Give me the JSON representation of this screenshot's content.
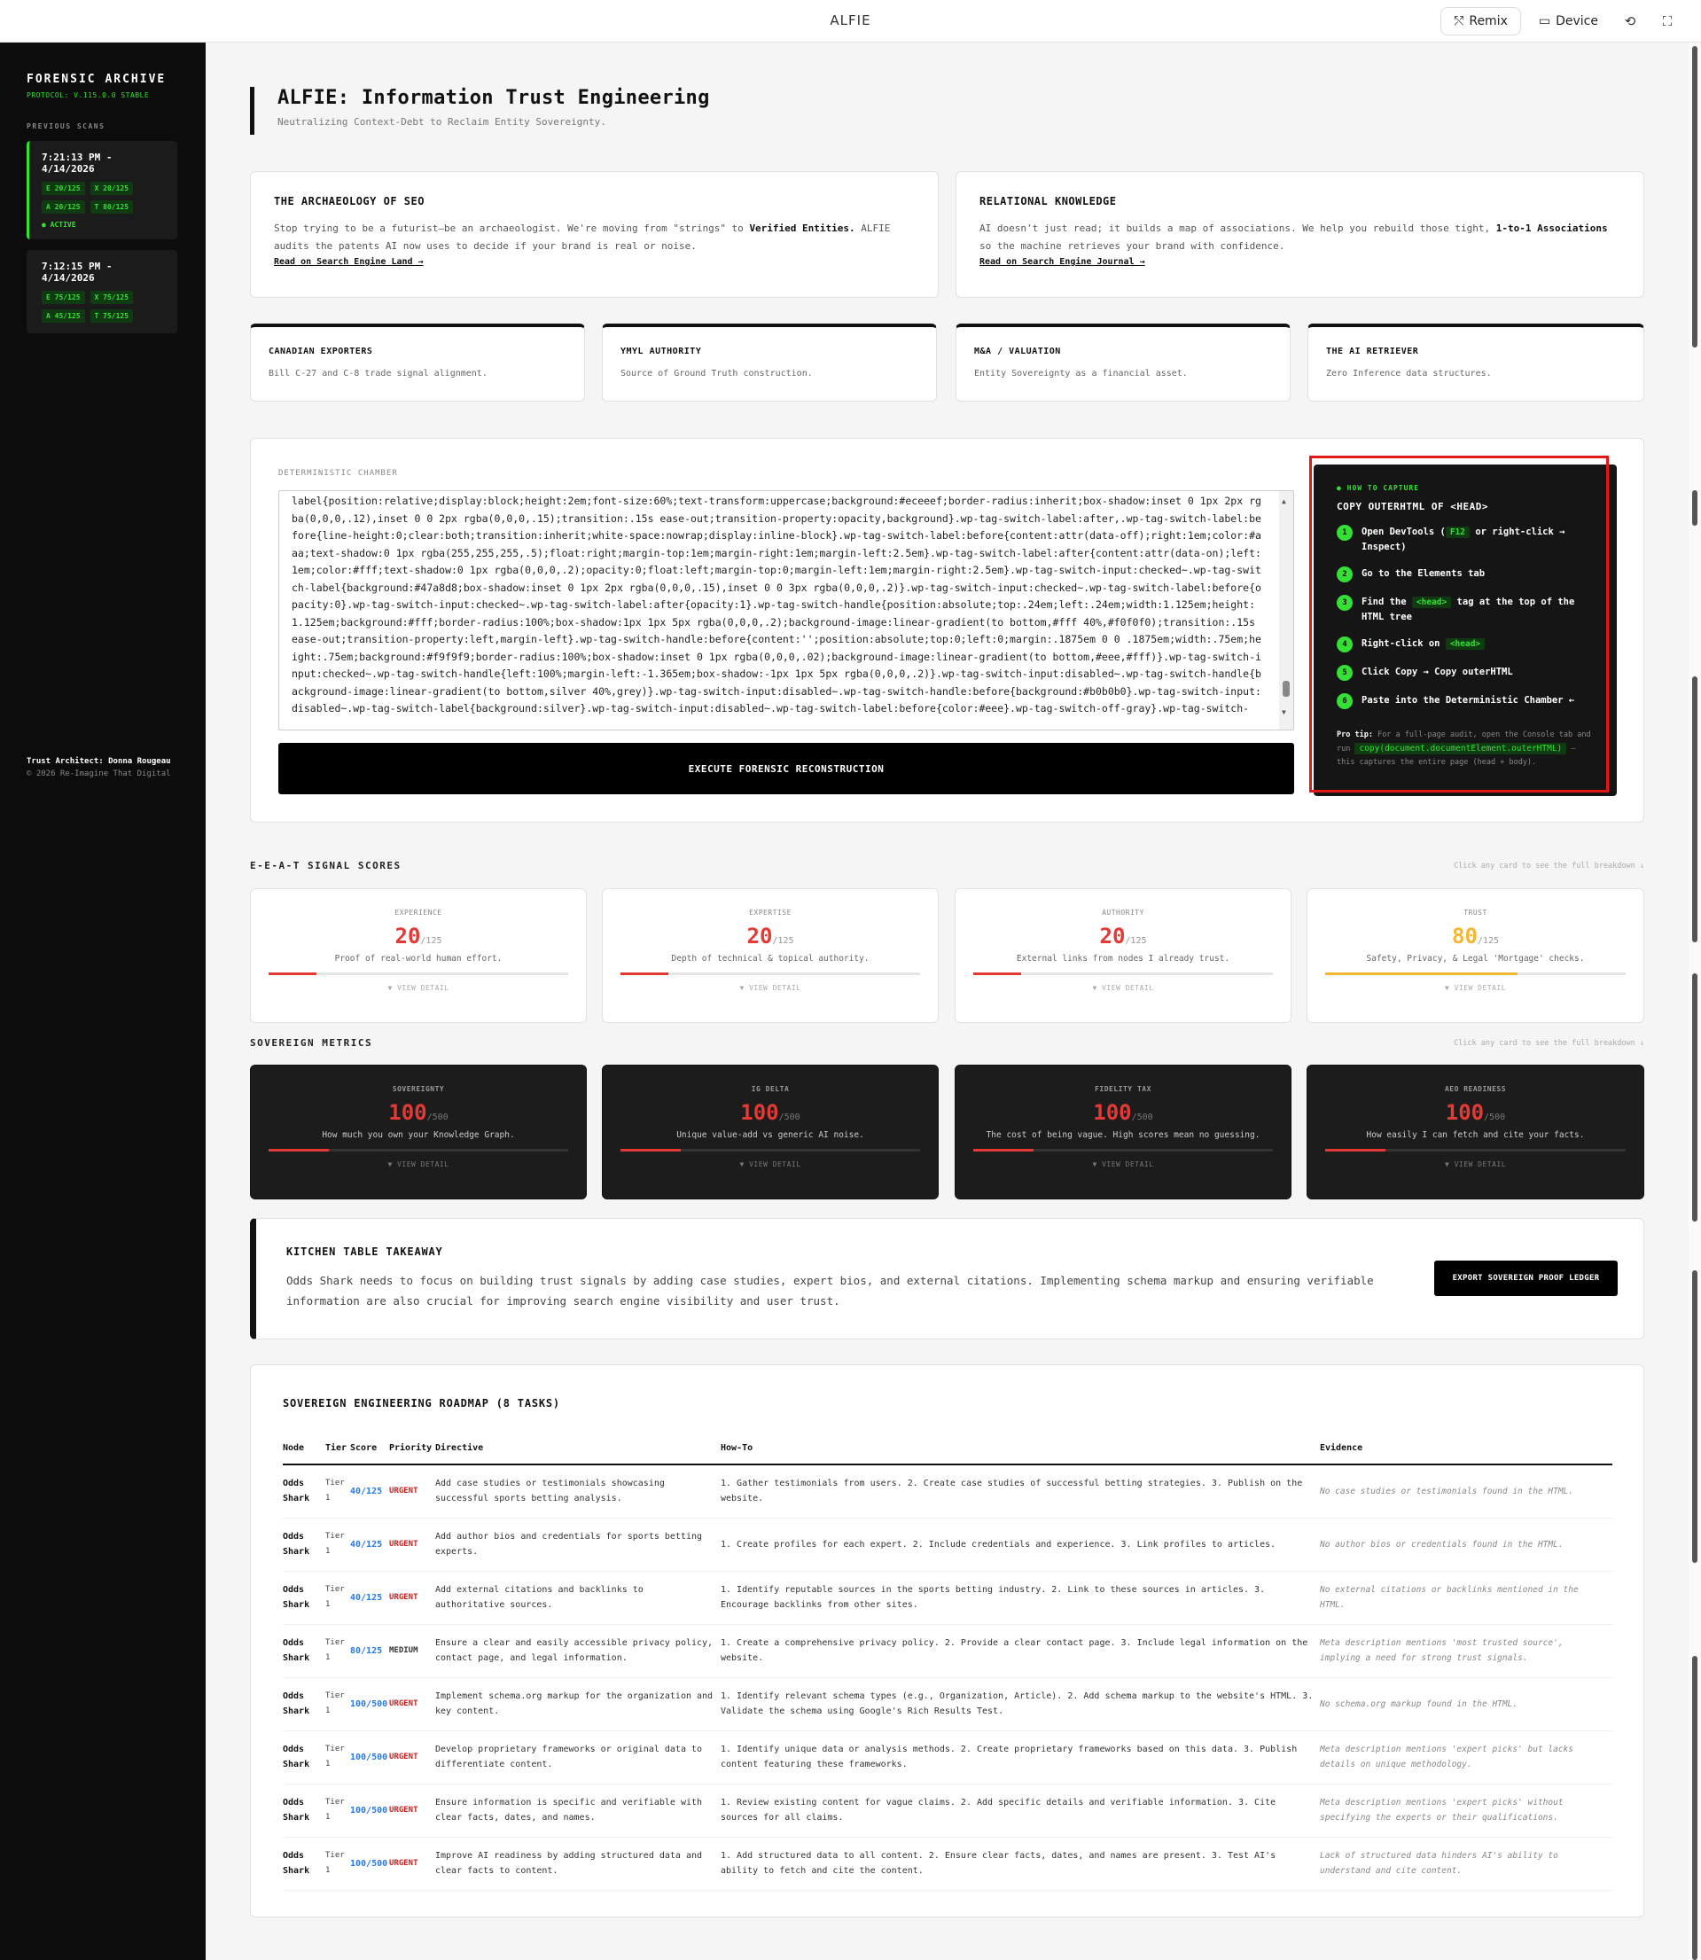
{
  "topbar": {
    "title": "ALFIE",
    "remix_label": "Remix",
    "device_label": "Device"
  },
  "sidebar": {
    "brand": "FORENSIC ARCHIVE",
    "protocol": "PROTOCOL: V.115.0.0 STABLE",
    "previous_label": "PREVIOUS SCANS",
    "scans": [
      {
        "time": "7:21:13 PM - 4/14/2026",
        "pills": [
          "E 20/125",
          "X 20/125",
          "A 20/125",
          "T 80/125"
        ],
        "status": "● ACTIVE"
      },
      {
        "time": "7:12:15 PM - 4/14/2026",
        "pills": [
          "E 75/125",
          "X 75/125",
          "A 45/125",
          "T 75/125"
        ],
        "status": ""
      }
    ],
    "architect": "Trust Architect: Donna Rougeau",
    "copyright": "© 2026 Re-Imagine That Digital"
  },
  "hero": {
    "title": "ALFIE: Information Trust Engineering",
    "subtitle": "Neutralizing Context-Debt to Reclaim Entity Sovereignty."
  },
  "info_cards": [
    {
      "title": "THE ARCHAEOLOGY OF SEO",
      "body_pre": "Stop trying to be a futurist—be an archaeologist. We're moving from \"strings\" to ",
      "body_bold": "Verified Entities.",
      "body_post": " ALFIE audits the patents AI now uses to decide if your brand is real or noise.",
      "link": "Read on Search Engine Land →"
    },
    {
      "title": "RELATIONAL KNOWLEDGE",
      "body_pre": "AI doesn't just read; it builds a map of associations. We help you rebuild those tight, ",
      "body_bold": "1-to-1 Associations",
      "body_post": " so the machine retrieves your brand with confidence.",
      "link": "Read on Search Engine Journal →"
    }
  ],
  "mini_cards": [
    {
      "title": "CANADIAN EXPORTERS",
      "desc": "Bill C-27 and C-8 trade signal alignment."
    },
    {
      "title": "YMYL AUTHORITY",
      "desc": "Source of Ground Truth construction."
    },
    {
      "title": "M&A / VALUATION",
      "desc": "Entity Sovereignty as a financial asset."
    },
    {
      "title": "THE AI RETRIEVER",
      "desc": "Zero Inference data structures."
    }
  ],
  "chamber": {
    "label": "DETERMINISTIC CHAMBER",
    "code": "label{position:relative;display:block;height:2em;font-size:60%;text-transform:uppercase;background:#eceeef;border-radius:inherit;box-shadow:inset 0 1px 2px rgba(0,0,0,.12),inset 0 0 2px rgba(0,0,0,.15);transition:.15s ease-out;transition-property:opacity,background}.wp-tag-switch-label:after,.wp-tag-switch-label:before{line-height:0;clear:both;transition:inherit;white-space:nowrap;display:inline-block}.wp-tag-switch-label:before{content:attr(data-off);right:1em;color:#aaa;text-shadow:0 1px rgba(255,255,255,.5);float:right;margin-top:1em;margin-right:1em;margin-left:2.5em}.wp-tag-switch-label:after{content:attr(data-on);left:1em;color:#fff;text-shadow:0 1px rgba(0,0,0,.2);opacity:0;float:left;margin-top:0;margin-left:1em;margin-right:2.5em}.wp-tag-switch-input:checked~.wp-tag-switch-label{background:#47a8d8;box-shadow:inset 0 1px 2px rgba(0,0,0,.15),inset 0 0 3px rgba(0,0,0,.2)}.wp-tag-switch-input:checked~.wp-tag-switch-label:before{opacity:0}.wp-tag-switch-input:checked~.wp-tag-switch-label:after{opacity:1}.wp-tag-switch-handle{position:absolute;top:.24em;left:.24em;width:1.125em;height:1.125em;background:#fff;border-radius:100%;box-shadow:1px 1px 5px rgba(0,0,0,.2);background-image:linear-gradient(to bottom,#fff 40%,#f0f0f0);transition:.15s ease-out;transition-property:left,margin-left}.wp-tag-switch-handle:before{content:'';position:absolute;top:0;left:0;margin:.1875em 0 0 .1875em;width:.75em;height:.75em;background:#f9f9f9;border-radius:100%;box-shadow:inset 0 1px rgba(0,0,0,.02);background-image:linear-gradient(to bottom,#eee,#fff)}.wp-tag-switch-input:checked~.wp-tag-switch-handle{left:100%;margin-left:-1.365em;box-shadow:-1px 1px 5px rgba(0,0,0,.2)}.wp-tag-switch-input:disabled~.wp-tag-switch-handle{background-image:linear-gradient(to bottom,silver 40%,grey)}.wp-tag-switch-input:disabled~.wp-tag-switch-handle:before{background:#b0b0b0}.wp-tag-switch-input:disabled~.wp-tag-switch-label{background:silver}.wp-tag-switch-input:disabled~.wp-tag-switch-label:before{color:#eee}.wp-tag-switch-off-gray}.wp-tag-switch-",
    "execute_label": "EXECUTE FORENSIC RECONSTRUCTION"
  },
  "capture": {
    "how": "● HOW TO CAPTURE",
    "title": "COPY OUTERHTML OF <HEAD>",
    "steps": [
      {
        "n": "1",
        "pre": "Open DevTools (",
        "kbd": "F12",
        "post": " or right-click → Inspect)"
      },
      {
        "n": "2",
        "pre": "Go to the Elements tab",
        "kbd": "",
        "post": ""
      },
      {
        "n": "3",
        "pre": "Find the ",
        "kbd": "<head>",
        "post": " tag at the top of the HTML tree"
      },
      {
        "n": "4",
        "pre": "Right-click on ",
        "kbd": "<head>",
        "post": ""
      },
      {
        "n": "5",
        "pre": "Click Copy → Copy outerHTML",
        "kbd": "",
        "post": ""
      },
      {
        "n": "6",
        "pre": "Paste into the Deterministic Chamber ←",
        "kbd": "",
        "post": ""
      }
    ],
    "tip_label": "Pro tip:",
    "tip_pre": " For a full-page audit, open the Console tab and run ",
    "tip_code": "copy(document.documentElement.outerHTML)",
    "tip_post": " — this captures the entire page (head + body)."
  },
  "eeat": {
    "heading": "E-E-A-T SIGNAL SCORES",
    "hint": "Click any card to see the full breakdown ↓",
    "cards": [
      {
        "label": "EXPERIENCE",
        "score": "20",
        "max": "/125",
        "fraction": 0.16,
        "color": "#e53935",
        "desc": "Proof of real-world human effort.",
        "detail": "▼ VIEW DETAIL"
      },
      {
        "label": "EXPERTISE",
        "score": "20",
        "max": "/125",
        "fraction": 0.16,
        "color": "#e53935",
        "desc": "Depth of technical & topical authority.",
        "detail": "▼ VIEW DETAIL"
      },
      {
        "label": "AUTHORITY",
        "score": "20",
        "max": "/125",
        "fraction": 0.16,
        "color": "#e53935",
        "desc": "External links from nodes I already trust.",
        "detail": "▼ VIEW DETAIL"
      },
      {
        "label": "TRUST",
        "score": "80",
        "max": "/125",
        "fraction": 0.64,
        "color": "#f5b731",
        "desc": "Safety, Privacy, & Legal 'Mortgage' checks.",
        "detail": "▼ VIEW DETAIL"
      }
    ]
  },
  "sovereign": {
    "heading": "SOVEREIGN METRICS",
    "hint": "Click any card to see the full breakdown ↓",
    "cards": [
      {
        "label": "SOVEREIGNTY",
        "score": "100",
        "max": "/500",
        "fraction": 0.2,
        "color": "#e53935",
        "desc": "How much you own your Knowledge Graph.",
        "detail": "▼ VIEW DETAIL"
      },
      {
        "label": "IG DELTA",
        "score": "100",
        "max": "/500",
        "fraction": 0.2,
        "color": "#e53935",
        "desc": "Unique value-add vs generic AI noise.",
        "detail": "▼ VIEW DETAIL"
      },
      {
        "label": "FIDELITY TAX",
        "score": "100",
        "max": "/500",
        "fraction": 0.2,
        "color": "#e53935",
        "desc": "The cost of being vague. High scores mean no guessing.",
        "detail": "▼ VIEW DETAIL"
      },
      {
        "label": "AEO READINESS",
        "score": "100",
        "max": "/500",
        "fraction": 0.2,
        "color": "#e53935",
        "desc": "How easily I can fetch and cite your facts.",
        "detail": "▼ VIEW DETAIL"
      }
    ]
  },
  "takeaway": {
    "title": "KITCHEN TABLE TAKEAWAY",
    "body": "Odds Shark needs to focus on building trust signals by adding case studies, expert bios, and external citations. Implementing schema markup and ensuring verifiable information are also crucial for improving search engine visibility and user trust.",
    "export_label": "EXPORT SOVEREIGN PROOF LEDGER"
  },
  "roadmap": {
    "title": "SOVEREIGN ENGINEERING ROADMAP (8 TASKS)",
    "columns": [
      "Node",
      "Tier",
      "Score",
      "Priority",
      "Directive",
      "How-To",
      "Evidence"
    ],
    "rows": [
      {
        "node": "Odds Shark",
        "tier": "Tier 1",
        "score": "40/125",
        "priority": "URGENT",
        "directive": "Add case studies or testimonials showcasing successful sports betting analysis.",
        "howto": "1. Gather testimonials from users. 2. Create case studies of successful betting strategies. 3. Publish on the website.",
        "evidence": "No case studies or testimonials found in the HTML."
      },
      {
        "node": "Odds Shark",
        "tier": "Tier 1",
        "score": "40/125",
        "priority": "URGENT",
        "directive": "Add author bios and credentials for sports betting experts.",
        "howto": "1. Create profiles for each expert. 2. Include credentials and experience. 3. Link profiles to articles.",
        "evidence": "No author bios or credentials found in the HTML."
      },
      {
        "node": "Odds Shark",
        "tier": "Tier 1",
        "score": "40/125",
        "priority": "URGENT",
        "directive": "Add external citations and backlinks to authoritative sources.",
        "howto": "1. Identify reputable sources in the sports betting industry. 2. Link to these sources in articles. 3. Encourage backlinks from other sites.",
        "evidence": "No external citations or backlinks mentioned in the HTML."
      },
      {
        "node": "Odds Shark",
        "tier": "Tier 1",
        "score": "80/125",
        "priority": "MEDIUM",
        "directive": "Ensure a clear and easily accessible privacy policy, contact page, and legal information.",
        "howto": "1. Create a comprehensive privacy policy. 2. Provide a clear contact page. 3. Include legal information on the website.",
        "evidence": "Meta description mentions 'most trusted source', implying a need for strong trust signals."
      },
      {
        "node": "Odds Shark",
        "tier": "Tier 1",
        "score": "100/500",
        "priority": "URGENT",
        "directive": "Implement schema.org markup for the organization and key content.",
        "howto": "1. Identify relevant schema types (e.g., Organization, Article). 2. Add schema markup to the website's HTML. 3. Validate the schema using Google's Rich Results Test.",
        "evidence": "No schema.org markup found in the HTML."
      },
      {
        "node": "Odds Shark",
        "tier": "Tier 1",
        "score": "100/500",
        "priority": "URGENT",
        "directive": "Develop proprietary frameworks or original data to differentiate content.",
        "howto": "1. Identify unique data or analysis methods. 2. Create proprietary frameworks based on this data. 3. Publish content featuring these frameworks.",
        "evidence": "Meta description mentions 'expert picks' but lacks details on unique methodology."
      },
      {
        "node": "Odds Shark",
        "tier": "Tier 1",
        "score": "100/500",
        "priority": "URGENT",
        "directive": "Ensure information is specific and verifiable with clear facts, dates, and names.",
        "howto": "1. Review existing content for vague claims. 2. Add specific details and verifiable information. 3. Cite sources for all claims.",
        "evidence": "Meta description mentions 'expert picks' without specifying the experts or their qualifications."
      },
      {
        "node": "Odds Shark",
        "tier": "Tier 1",
        "score": "100/500",
        "priority": "URGENT",
        "directive": "Improve AI readiness by adding structured data and clear facts to content.",
        "howto": "1. Add structured data to all content. 2. Ensure clear facts, dates, and names are present. 3. Test AI's ability to fetch and cite the content.",
        "evidence": "Lack of structured data hinders AI's ability to understand and cite content."
      }
    ]
  }
}
